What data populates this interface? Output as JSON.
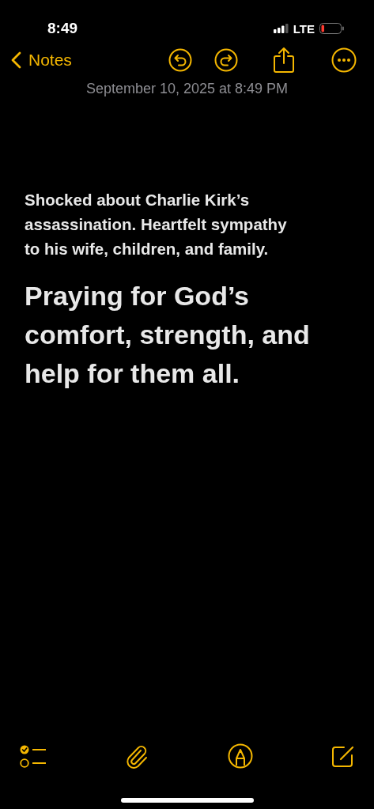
{
  "status_bar": {
    "time": "8:49",
    "network": "LTE"
  },
  "nav": {
    "back_label": "Notes"
  },
  "note": {
    "date": "September 10, 2025 at 8:49 PM",
    "paragraphs": [
      {
        "kind": "body",
        "text": "Shocked about Charlie Kirk’s assassination.  Heartfelt sympathy to his wife, children, and family."
      },
      {
        "kind": "heading",
        "text": "Praying for God’s comfort, strength, and help for them all."
      }
    ]
  }
}
